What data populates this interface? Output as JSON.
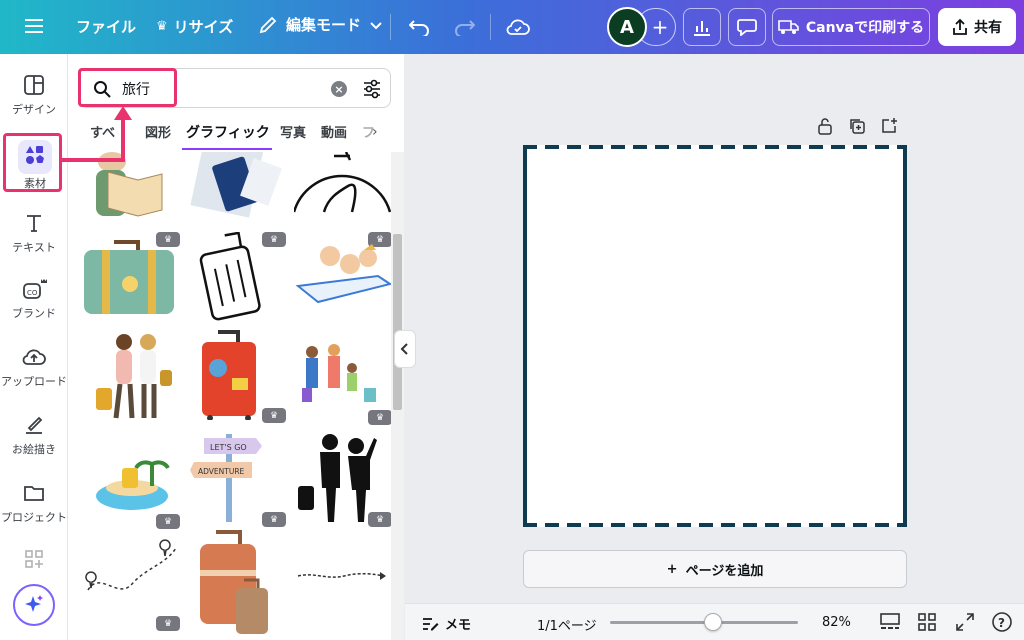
{
  "topbar": {
    "file_label": "ファイル",
    "resize_label": "リサイズ",
    "edit_mode_label": "編集モード",
    "avatar_initial": "A",
    "print_label": "Canvaで印刷する",
    "share_label": "共有",
    "gradient_colors": [
      "#20b8c8",
      "#3b6fd9",
      "#7d3fe0"
    ]
  },
  "rail": {
    "items": [
      {
        "label": "デザイン",
        "icon": "layout-icon"
      },
      {
        "label": "素材",
        "icon": "shapes-icon",
        "active": true
      },
      {
        "label": "テキスト",
        "icon": "text-icon"
      },
      {
        "label": "ブランド",
        "icon": "brand-icon"
      },
      {
        "label": "アップロード",
        "icon": "upload-icon"
      },
      {
        "label": "お絵描き",
        "icon": "pen-icon"
      },
      {
        "label": "プロジェクト",
        "icon": "folder-icon"
      }
    ]
  },
  "search": {
    "value": "旅行"
  },
  "tabs": [
    {
      "label": "すべ"
    },
    {
      "label": "図形"
    },
    {
      "label": "グラフィック",
      "active": true
    },
    {
      "label": "写真"
    },
    {
      "label": "動画"
    },
    {
      "label": "フ"
    }
  ],
  "graphics": [
    "traveler-with-map",
    "passport-and-tickets",
    "globe-line-drawing",
    "vintage-suitcase",
    "line-art-suitcase",
    "family-on-airplane",
    "couple-with-luggage",
    "red-suitcase-stickers",
    "family-travelers",
    "island-with-luggage",
    "lets-go-adventure-signpost",
    "couple-silhouette",
    "dotted-travel-path",
    "brown-luggage-set",
    "dotted-arrow"
  ],
  "graphic_texts": {
    "sign_top": "LET'S GO",
    "sign_bottom": "ADVENTURE"
  },
  "canvas": {
    "add_page_label": "ページを追加",
    "add_page_prefix": "+"
  },
  "bottombar": {
    "memo_label": "メモ",
    "page_indicator": "1/1ページ",
    "zoom": "82%",
    "zoom_fraction": 0.55
  },
  "highlight_color": "#e8336e",
  "accent_color": "#8b3dff"
}
